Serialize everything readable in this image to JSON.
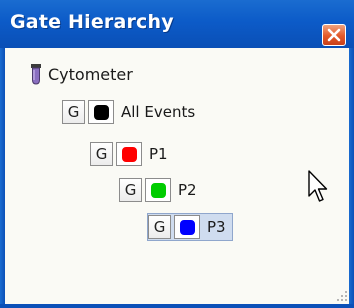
{
  "window": {
    "title": "Gate Hierarchy",
    "close_icon": "close-icon",
    "title_bar_color": "#0c5bc8",
    "close_button_color": "#e2592a"
  },
  "tree": {
    "root": {
      "label": "Cytometer",
      "icon": "test-tube-icon"
    },
    "nodes": [
      {
        "gate_button": "G",
        "label": "All Events",
        "color": "#000000",
        "selected": false
      },
      {
        "gate_button": "G",
        "label": "P1",
        "color": "#ff0000",
        "selected": false
      },
      {
        "gate_button": "G",
        "label": "P2",
        "color": "#00cc00",
        "selected": false
      },
      {
        "gate_button": "G",
        "label": "P3",
        "color": "#0000ff",
        "selected": true
      }
    ]
  },
  "cursor": {
    "icon": "mouse-pointer-icon"
  }
}
